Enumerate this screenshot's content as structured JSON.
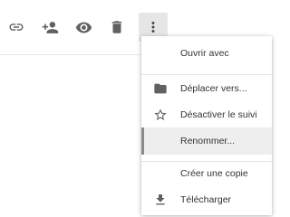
{
  "toolbar": {
    "buttons": [
      {
        "name": "link-icon"
      },
      {
        "name": "share-icon"
      },
      {
        "name": "preview-icon"
      },
      {
        "name": "trash-icon"
      },
      {
        "name": "more-vert-icon",
        "active": true
      }
    ]
  },
  "menu": {
    "items": [
      {
        "label": "Ouvrir avec",
        "icon": null
      },
      {
        "label": "Déplacer vers...",
        "icon": "folder-icon"
      },
      {
        "label": "Désactiver le suivi",
        "icon": "star-outline-icon"
      },
      {
        "label": "Renommer...",
        "icon": null,
        "highlighted": true
      },
      {
        "label": "Créer une copie",
        "icon": null
      },
      {
        "label": "Télécharger",
        "icon": "download-icon"
      }
    ]
  },
  "colors": {
    "icon": "#616161",
    "text": "#333333",
    "highlight_bg": "#eeeeee",
    "highlight_bar": "#8a8a8a",
    "separator": "#e3e3e3"
  }
}
